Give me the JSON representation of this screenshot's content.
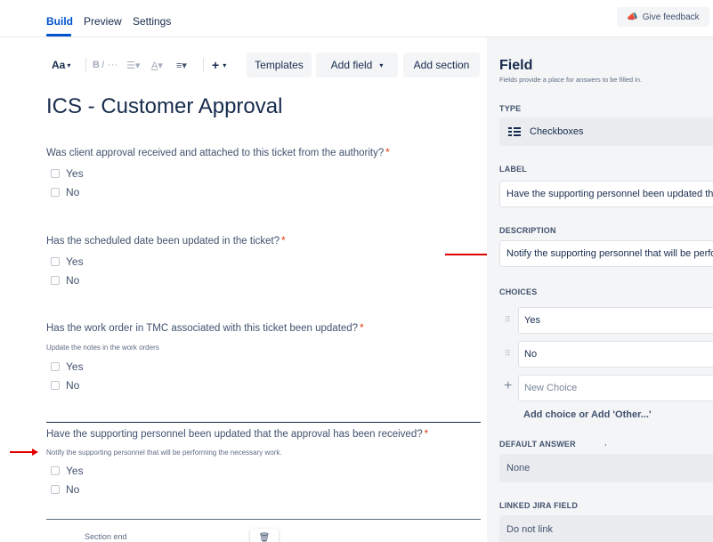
{
  "tabs": [
    {
      "label": "Build",
      "active": true
    },
    {
      "label": "Preview",
      "active": false
    },
    {
      "label": "Settings",
      "active": false
    }
  ],
  "feedback": {
    "label": "Give feedback",
    "icon": "megaphone-icon"
  },
  "toolbar": {
    "text_style": "Aa",
    "bold": "B",
    "italic": "I",
    "more": "···",
    "templates": "Templates",
    "add_field": "Add field",
    "add_section": "Add section"
  },
  "form": {
    "title": "ICS - Customer Approval",
    "questions": [
      {
        "label": "Was client approval received and attached to this ticket from the authority?",
        "required": "*",
        "description": "",
        "choices": [
          "Yes",
          "No"
        ]
      },
      {
        "label": "Has the scheduled date been updated in the ticket?",
        "required": "*",
        "description": "",
        "choices": [
          "Yes",
          "No"
        ]
      },
      {
        "label": "Has the work order in TMC associated with this ticket been updated?",
        "required": "*",
        "description": "Update the notes in the work orders",
        "choices": [
          "Yes",
          "No"
        ]
      },
      {
        "label": "Have the supporting personnel been updated that the approval has been received?",
        "required": "*",
        "description": "Notify the supporting personnel that will be performing the necessary work.",
        "choices": [
          "Yes",
          "No"
        ]
      }
    ],
    "section_end": "Section end"
  },
  "panel": {
    "title": "Field",
    "subtitle": "Fields provide a place for answers to be filled in.",
    "type_label": "TYPE",
    "type_value": "Checkboxes",
    "label_label": "LABEL",
    "label_value": "Have the supporting personnel been updated that the approval has been received?",
    "description_label": "DESCRIPTION",
    "description_value": "Notify the supporting personnel that will be performing the necessary work.",
    "choices_label": "CHOICES",
    "choices": [
      "Yes",
      "No"
    ],
    "new_choice_placeholder": "New Choice",
    "add_choice": "Add choice or Add 'Other...'",
    "default_answer_label": "DEFAULT ANSWER",
    "default_answer_value": "None",
    "linked_jira_label": "LINKED JIRA FIELD",
    "linked_jira_value": "Do not link"
  },
  "colors": {
    "accent": "#0052cc",
    "required": "#de350b",
    "annotation_arrow": "#e00000",
    "panel_bg": "#f4f5f7"
  }
}
